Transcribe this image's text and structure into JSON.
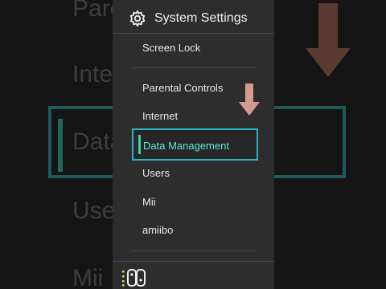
{
  "background": {
    "words": [
      "Parental Controls",
      "Internet",
      "Data Management",
      "Users",
      "Mii"
    ]
  },
  "header": {
    "title": "System Settings",
    "icon": "gear-icon"
  },
  "menu": {
    "items": [
      {
        "label": "Screen Lock"
      },
      {
        "label": "Parental Controls"
      },
      {
        "label": "Internet"
      },
      {
        "label": "Data Management",
        "selected": true
      },
      {
        "label": "Users"
      },
      {
        "label": "Mii"
      },
      {
        "label": "amiibo"
      }
    ]
  },
  "footer": {
    "icon": "joycon-controller-icon"
  },
  "colors": {
    "panel": "#2d2d2d",
    "selection_border": "#2bb6c8",
    "selection_text": "#5ee8d4",
    "arrow": "#d49a8e"
  }
}
